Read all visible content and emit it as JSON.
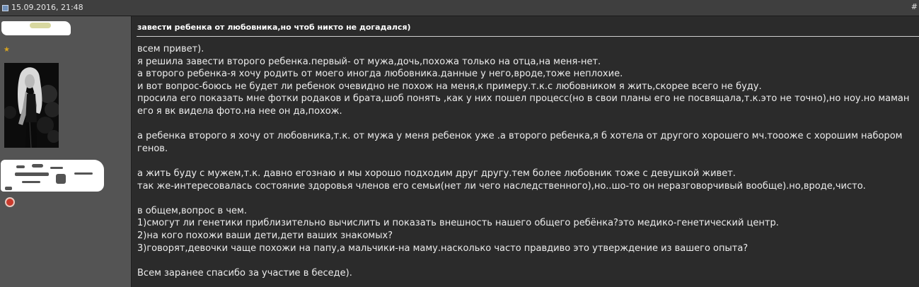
{
  "header": {
    "date": "15.09.2016, 21:48",
    "number": "#"
  },
  "user": {
    "star": "★"
  },
  "post": {
    "title": "завести ребенка от любовника,но чтоб никто не догадался)",
    "body": [
      "всем привет).",
      "я решила завести второго ребенка.первый- от мужа,дочь,похожа только на отца,на меня-нет.",
      "а второго ребенка-я хочу родить от моего иногда любовника.данные у него,вроде,тоже неплохие.",
      "и вот вопрос-боюсь не будет ли ребенок очевидно не похож на меня,к примеру.т.к.с любовником я жить,скорее всего не буду.",
      "просила его показать мне фотки родаков и брата,шоб понять ,как у них пошел процесс(но в свои планы его не посвящала,т.к.это не точно),но ноу.но маман",
      "его я вк видела фото.на нее он да,похож.",
      "",
      "а ребенка второго я хочу от любовника,т.к. от мужа у меня ребенок уже .а второго ребенка,я б хотела от другого хорошего мч.тоооже с хорошим набором",
      "генов.",
      "",
      "а жить буду с мужем,т.к. давно егознаю и мы хорошо подходим друг другу.тем более любовник тоже с девушкой живет.",
      "так же-интересовалась состояние здоровья членов его семьи(нет ли чего наследственного),но..шо-то он неразговорчивый вообще).но,вроде,чисто.",
      "",
      "в общем,вопрос в чем.",
      "1)смогут ли генетики приблизительно вычислить и показать внешность нашего общего ребёнка?это медико-генетический центр.",
      "2)на кого похожи ваши дети,дети ваших знакомых?",
      "3)говорят,девочки чаще похожи на папу,а мальчики-на маму.насколько часто правдиво это утверждение из вашего опыта?",
      "",
      "Всем заранее спасибо за участие в беседе)."
    ]
  },
  "colors": {
    "header_bg": "#3f3f3f",
    "sidebar_bg": "#545454",
    "content_bg": "#2b2b2b",
    "text": "#ececec",
    "title": "#ffffff"
  },
  "icons": {
    "post_icon": "post-icon",
    "star": "star-icon",
    "reputation": "reputation-icon"
  }
}
